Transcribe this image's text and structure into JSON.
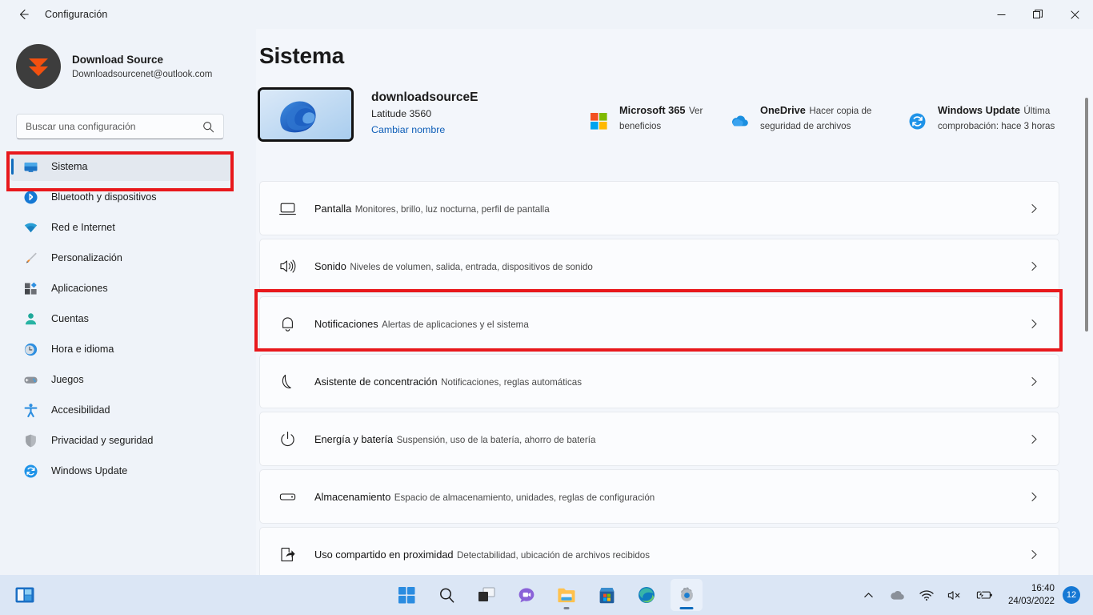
{
  "window": {
    "title": "Configuración",
    "back_icon": "arrow-left-icon",
    "minimize_label": "—",
    "maximize_label": "❐",
    "close_label": "✕"
  },
  "account": {
    "name": "Download Source",
    "email": "Downloadsourcenet@outlook.com",
    "avatar_icon": "download-source-logo"
  },
  "search": {
    "placeholder": "Buscar una configuración",
    "icon": "search-icon"
  },
  "sidebar": {
    "items": [
      {
        "label": "Sistema",
        "icon": "monitor-icon",
        "selected": true
      },
      {
        "label": "Bluetooth y dispositivos",
        "icon": "bluetooth-icon",
        "selected": false
      },
      {
        "label": "Red e Internet",
        "icon": "wifi-icon",
        "selected": false
      },
      {
        "label": "Personalización",
        "icon": "paintbrush-icon",
        "selected": false
      },
      {
        "label": "Aplicaciones",
        "icon": "apps-icon",
        "selected": false
      },
      {
        "label": "Cuentas",
        "icon": "person-icon",
        "selected": false
      },
      {
        "label": "Hora e idioma",
        "icon": "clock-icon",
        "selected": false
      },
      {
        "label": "Juegos",
        "icon": "gamepad-icon",
        "selected": false
      },
      {
        "label": "Accesibilidad",
        "icon": "accessibility-icon",
        "selected": false
      },
      {
        "label": "Privacidad y seguridad",
        "icon": "shield-icon",
        "selected": false
      },
      {
        "label": "Windows Update",
        "icon": "update-icon",
        "selected": false
      }
    ]
  },
  "main": {
    "page_title": "Sistema",
    "device": {
      "name": "downloadsourceE",
      "model": "Latitude 3560",
      "rename_link": "Cambiar nombre",
      "thumb_icon": "windows-11-bloom-wallpaper"
    },
    "quick_links": [
      {
        "title": "Microsoft 365",
        "subtitle": "Ver beneficios",
        "icon": "microsoft-365-icon"
      },
      {
        "title": "OneDrive",
        "subtitle": "Hacer copia de seguridad de archivos",
        "icon": "onedrive-icon"
      },
      {
        "title": "Windows Update",
        "subtitle": "Última comprobación: hace 3 horas",
        "icon": "update-icon"
      }
    ],
    "cards": [
      {
        "title": "Pantalla",
        "subtitle": "Monitores, brillo, luz nocturna, perfil de pantalla",
        "icon": "display-icon",
        "highlighted": false
      },
      {
        "title": "Sonido",
        "subtitle": "Niveles de volumen, salida, entrada, dispositivos de sonido",
        "icon": "speaker-icon",
        "highlighted": false
      },
      {
        "title": "Notificaciones",
        "subtitle": "Alertas de aplicaciones y el sistema",
        "icon": "bell-icon",
        "highlighted": true
      },
      {
        "title": "Asistente de concentración",
        "subtitle": "Notificaciones, reglas automáticas",
        "icon": "moon-icon",
        "highlighted": false
      },
      {
        "title": "Energía y batería",
        "subtitle": "Suspensión, uso de la batería, ahorro de batería",
        "icon": "power-icon",
        "highlighted": false
      },
      {
        "title": "Almacenamiento",
        "subtitle": "Espacio de almacenamiento, unidades, reglas de configuración",
        "icon": "storage-icon",
        "highlighted": false
      },
      {
        "title": "Uso compartido en proximidad",
        "subtitle": "Detectabilidad, ubicación de archivos recibidos",
        "icon": "share-icon",
        "highlighted": false
      }
    ],
    "chevron_icon": "chevron-right-icon"
  },
  "annotations": {
    "color": "#e8181c",
    "boxes": [
      {
        "target": "sidebar-item-sistema"
      },
      {
        "target": "card-notificaciones"
      }
    ]
  },
  "taskbar": {
    "widgets_icon": "widgets-icon",
    "items": [
      {
        "icon": "start-icon",
        "state": "idle"
      },
      {
        "icon": "search-icon",
        "state": "idle"
      },
      {
        "icon": "task-view-icon",
        "state": "idle"
      },
      {
        "icon": "chat-icon",
        "state": "idle"
      },
      {
        "icon": "file-explorer-icon",
        "state": "running"
      },
      {
        "icon": "microsoft-store-icon",
        "state": "idle"
      },
      {
        "icon": "edge-icon",
        "state": "idle"
      },
      {
        "icon": "settings-icon",
        "state": "active"
      }
    ],
    "tray": {
      "chevron_icon": "chevron-up-icon",
      "onedrive_icon": "cloud-icon",
      "network_icon": "wifi-icon",
      "volume_icon": "volume-muted-icon",
      "battery_icon": "battery-charging-icon",
      "time": "16:40",
      "date": "24/03/2022",
      "notification_count": "12"
    }
  }
}
